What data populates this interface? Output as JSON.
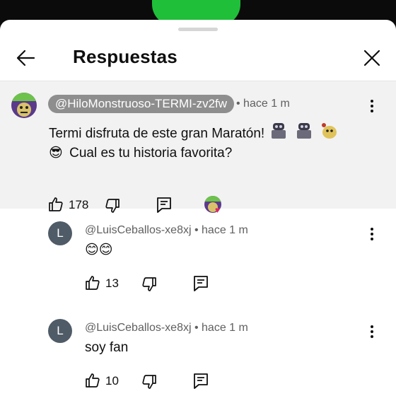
{
  "header": {
    "title": "Respuestas"
  },
  "parent_comment": {
    "author": "@HiloMonstruoso-TERMI-zv2fw",
    "time": "• hace 1 m",
    "line1": "Termi disfruta de este gran Maratón!",
    "line2": "Cual es tu historia favorita?",
    "likes": "178",
    "emoji_line2": "😎"
  },
  "replies": [
    {
      "avatar_letter": "L",
      "author": "@LuisCeballos-xe8xj",
      "time": "• hace 1 m",
      "text": "😊😊",
      "likes": "13"
    },
    {
      "avatar_letter": "L",
      "author": "@LuisCeballos-xe8xj",
      "time": "• hace 1 m",
      "text": "soy fan",
      "likes": "10"
    }
  ],
  "icons": {
    "back": "arrow-left-icon",
    "close": "close-icon",
    "more": "more-vert-icon",
    "like": "thumb-up-icon",
    "dislike": "thumb-down-icon",
    "reply": "comment-icon"
  },
  "colors": {
    "accent_heart": "#e0245e",
    "avatar_gray": "#4f5b66",
    "pill_bg": "#8e8e8e",
    "highlight_bg": "#f2f2f2"
  }
}
